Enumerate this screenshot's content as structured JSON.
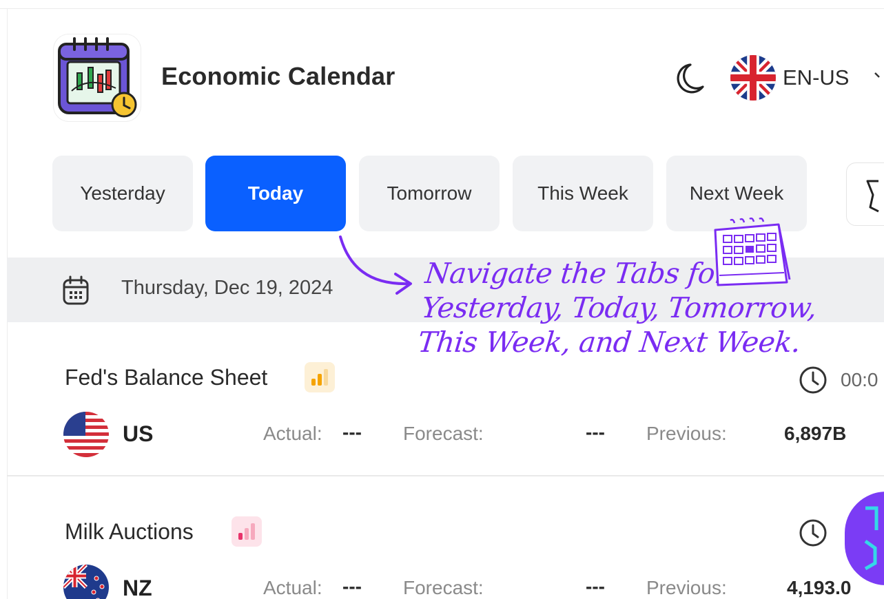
{
  "app": {
    "title": "Economic Calendar"
  },
  "header": {
    "language": "EN-US"
  },
  "tabs": [
    {
      "label": "Yesterday",
      "active": false
    },
    {
      "label": "Today",
      "active": true
    },
    {
      "label": "Tomorrow",
      "active": false
    },
    {
      "label": "This Week",
      "active": false
    },
    {
      "label": "Next Week",
      "active": false
    }
  ],
  "date_bar": {
    "date": "Thursday, Dec 19, 2024"
  },
  "events": [
    {
      "title": "Fed's Balance Sheet",
      "importance": "medium",
      "time": "00:0",
      "country": "US",
      "actual_label": "Actual:",
      "actual": "---",
      "forecast_label": "Forecast:",
      "forecast": "---",
      "previous_label": "Previous:",
      "previous": "6,897B"
    },
    {
      "title": "Milk Auctions",
      "importance": "low",
      "time": "",
      "country": "NZ",
      "actual_label": "Actual:",
      "actual": "---",
      "forecast_label": "Forecast:",
      "forecast": "---",
      "previous_label": "Previous:",
      "previous": "4,193.0"
    }
  ],
  "annotation": {
    "lines": [
      "Navigate the Tabs for",
      "Yesterday, Today, Tomorrow,",
      "This Week, and Next Week."
    ]
  },
  "colors": {
    "accent": "#0a60ff",
    "annotation": "#7a2cf2",
    "medium_importance": "#f5a300",
    "low_importance": "#e8336b"
  }
}
